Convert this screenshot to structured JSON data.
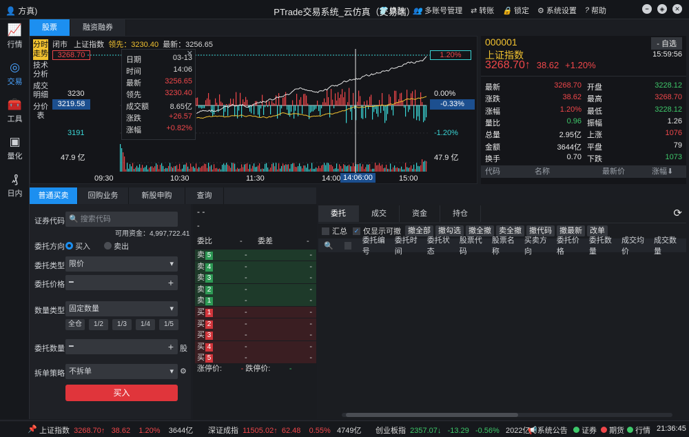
{
  "window": {
    "title": "PTrade交易系统_云仿真（交易端）",
    "user": "方真)",
    "menu": [
      "换肤",
      "多账号管理",
      "转账",
      "锁定",
      "系统设置",
      "帮助"
    ]
  },
  "sidebar": {
    "items": [
      "行情",
      "交易",
      "工具",
      "量化",
      "日内"
    ]
  },
  "top_tabs": [
    "股票",
    "融资融券"
  ],
  "chart": {
    "status": "闭市",
    "index_name": "上证指数",
    "lead_label": "领先：3230.40",
    "latest_label": "最新：3256.65",
    "vert_tabs": [
      "分时走势",
      "技术分析",
      "成交明细",
      "分价表"
    ],
    "y_left": {
      "top": "3268.70",
      "mid": "3230",
      "cross": "3219.58",
      "low": "3191",
      "vol": "47.9 亿"
    },
    "y_right": {
      "top": "1.20%",
      "mid": "0.00%",
      "cross": "-0.33%",
      "low": "-1.20%",
      "vol": "47.9 亿"
    },
    "x_axis": [
      "09:30",
      "10:30",
      "11:30",
      "14:00",
      "15:00"
    ],
    "cursor_time": "14:06:00",
    "tooltip": [
      [
        "日期",
        "03-13"
      ],
      [
        "时间",
        "14:06"
      ],
      [
        "最新",
        "3256.65"
      ],
      [
        "领先",
        "3230.40"
      ],
      [
        "成交额",
        "8.65亿"
      ],
      [
        "涨跌",
        "+26.57"
      ],
      [
        "涨幅",
        "+0.82%"
      ]
    ],
    "colors": {
      "up": "#f0474a",
      "down": "#3ad6d6",
      "price": "#e8e8e8",
      "lead": "#f2c230"
    }
  },
  "quote": {
    "code": "000001",
    "select_btn": "- 自选",
    "name": "上证指数",
    "price": "3268.70",
    "arrow": "↑",
    "change": "38.62",
    "pct": "+1.20%",
    "time": "15:59:56",
    "rows": [
      [
        "最新",
        "3268.70",
        "开盘",
        "3228.12"
      ],
      [
        "涨跌",
        "38.62",
        "最高",
        "3268.70"
      ],
      [
        "涨幅",
        "1.20%",
        "最低",
        "3228.12"
      ],
      [
        "量比",
        "0.96",
        "振幅",
        "1.26"
      ],
      [
        "总量",
        "2.95亿",
        "上涨",
        "1076"
      ],
      [
        "金额",
        "3644亿",
        "平盘",
        "79"
      ],
      [
        "换手",
        "0.70",
        "下跌",
        "1073"
      ]
    ],
    "table_headers": [
      "代码",
      "名称",
      "最新价",
      "涨幅"
    ]
  },
  "lower_tabs": [
    "普通买卖",
    "回购业务",
    "新股申购",
    "查询"
  ],
  "order": {
    "code_label": "证券代码",
    "code_placeholder": "搜索代码",
    "funds": "可用资金：4,997,722.41",
    "dir_label": "委托方向",
    "buy": "买入",
    "sell": "卖出",
    "type_label": "委托类型",
    "type_value": "限价",
    "price_label": "委托价格",
    "qty_type_label": "数量类型",
    "qty_type_value": "固定数量",
    "qty_buttons": [
      "全仓",
      "1/2",
      "1/3",
      "1/4",
      "1/5"
    ],
    "qty_label": "委托数量",
    "unit": "股",
    "split_label": "拆单策略",
    "split_value": "不拆单",
    "submit": "买入"
  },
  "book": {
    "top1": "-  -",
    "top2": "-",
    "ratio_label": "委比",
    "ratio_val": "-",
    "diff_label": "委差",
    "diff_val": "-",
    "asks": [
      [
        "卖",
        "5"
      ],
      [
        "卖",
        "4"
      ],
      [
        "卖",
        "3"
      ],
      [
        "卖",
        "2"
      ],
      [
        "卖",
        "1"
      ]
    ],
    "bids": [
      [
        "买",
        "1"
      ],
      [
        "买",
        "2"
      ],
      [
        "买",
        "3"
      ],
      [
        "买",
        "4"
      ],
      [
        "买",
        "5"
      ]
    ],
    "dash": "-",
    "limit_up": "涨停价:",
    "limit_up_val": "-",
    "limit_down": "跌停价:",
    "limit_down_val": "-"
  },
  "entrust": {
    "tabs": [
      "委托",
      "成交",
      "资金",
      "持仓"
    ],
    "summary": "汇总",
    "only_cancel": "仅显示可撤",
    "buttons": [
      "撤全部",
      "撤勾选",
      "撤全撤",
      "卖全撤",
      "撤代码",
      "撤最新",
      "改单"
    ],
    "columns": [
      "委托编号",
      "委托时间",
      "委托状态",
      "股票代码",
      "股票名称",
      "买卖方向",
      "委托价格",
      "委托数量",
      "成交均价",
      "成交数量"
    ]
  },
  "statusbar": {
    "sh": [
      "上证指数",
      "3268.70↑",
      "38.62",
      "1.20%",
      "3644亿"
    ],
    "sz": [
      "深证成指",
      "11505.02↑",
      "62.48",
      "0.55%",
      "4749亿"
    ],
    "cy": [
      "创业板指",
      "2357.07↓",
      "-13.29",
      "-0.56%",
      "2022亿"
    ],
    "notice": "系统公告",
    "legend": [
      "证券",
      "期货",
      "行情"
    ],
    "clock": "21:36:45"
  }
}
